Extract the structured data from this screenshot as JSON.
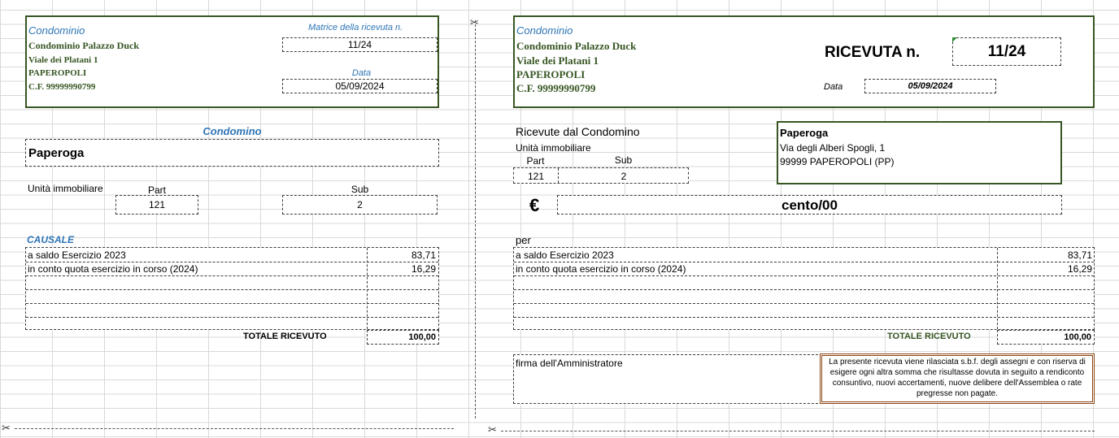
{
  "stub": {
    "condominio_label": "Condominio",
    "name": "Condominio Palazzo Duck",
    "street": "Viale dei Platani 1",
    "city": "PAPEROPOLI",
    "cf": "C.F. 99999990799",
    "matrice_label": "Matrice della ricevuta n.",
    "matrice_value": "11/24",
    "data_label": "Data",
    "data_value": "05/09/2024",
    "condomino_label": "Condomino",
    "condomino_name": "Paperoga",
    "unita_label": "Unità immobiliare",
    "part_label": "Part",
    "part_value": "121",
    "sub_label": "Sub",
    "sub_value": "2",
    "causale_label": "CAUSALE",
    "rows": [
      {
        "desc": "a saldo Esercizio 2023",
        "amount": "83,71"
      },
      {
        "desc": "in conto quota esercizio in corso (2024)",
        "amount": "16,29"
      },
      {
        "desc": "",
        "amount": ""
      },
      {
        "desc": "",
        "amount": ""
      },
      {
        "desc": "",
        "amount": ""
      }
    ],
    "totale_label": "TOTALE RICEVUTO",
    "totale_value": "100,00"
  },
  "receipt": {
    "condominio_label": "Condominio",
    "name": "Condominio Palazzo Duck",
    "street": "Viale dei Platani 1",
    "city": "PAPEROPOLI",
    "cf": "C.F. 99999990799",
    "ricevuta_label": "RICEVUTA n.",
    "ricevuta_value": "11/24",
    "data_label": "Data",
    "data_value": "05/09/2024",
    "ricevute_label": "Ricevute dal Condomino",
    "unita_label": "Unità immobiliare",
    "part_label": "Part",
    "part_value": "121",
    "sub_label": "Sub",
    "sub_value": "2",
    "payer_name": "Paperoga",
    "payer_street": "Via degli Alberi Spogli, 1",
    "payer_city": "99999 PAPEROPOLI (PP)",
    "euro_symbol": "€",
    "amount_words": "cento/00",
    "per_label": "per",
    "rows": [
      {
        "desc": "a saldo Esercizio 2023",
        "amount": "83,71"
      },
      {
        "desc": "in conto quota esercizio in corso (2024)",
        "amount": "16,29"
      },
      {
        "desc": "",
        "amount": ""
      },
      {
        "desc": "",
        "amount": ""
      },
      {
        "desc": "",
        "amount": ""
      }
    ],
    "totale_label": "TOTALE RICEVUTO",
    "totale_value": "100,00",
    "firma_label": "firma dell'Amministratore",
    "disclaimer": "La presente ricevuta viene rilasciata s.b.f. degli assegni e con riserva di esigere ogni altra somma che risultasse dovuta in seguito a rendiconto consuntivo, nuovi accertamenti, nuove delibere dell'Assemblea o rate pregresse non pagate."
  },
  "icons": {
    "scissors": "scissors-icon",
    "scissors_glyph": "✂"
  }
}
